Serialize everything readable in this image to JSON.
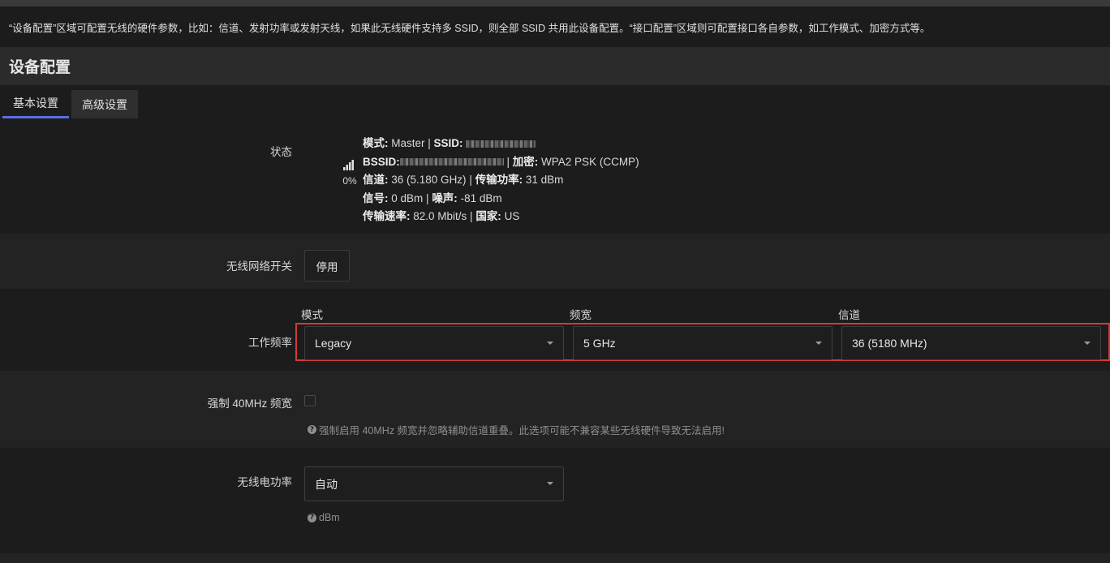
{
  "description": "“设备配置”区域可配置无线的硬件参数，比如：信道、发射功率或发射天线，如果此无线硬件支持多 SSID，则全部 SSID 共用此设备配置。“接口配置”区域则可配置接口各自参数，如工作模式、加密方式等。",
  "section_title": "设备配置",
  "tabs": [
    {
      "label": "基本设置",
      "active": true
    },
    {
      "label": "高级设置",
      "active": false
    }
  ],
  "status": {
    "label": "状态",
    "signal_percent": "0%",
    "signal_icon": "signal-bars-icon",
    "mode_label": "模式:",
    "mode_value": "Master",
    "ssid_label": "SSID:",
    "bssid_label": "BSSID:",
    "encryption_label": "加密:",
    "encryption_value": "WPA2 PSK (CCMP)",
    "channel_label": "信道:",
    "channel_value": "36 (5.180 GHz)",
    "txpower_label": "传输功率:",
    "txpower_value": "31 dBm",
    "signal_label": "信号:",
    "signal_value": "0 dBm",
    "noise_label": "噪声:",
    "noise_value": "-81 dBm",
    "bitrate_label": "传输速率:",
    "bitrate_value": "82.0 Mbit/s",
    "country_label": "国家:",
    "country_value": "US"
  },
  "wireless_switch": {
    "label": "无线网络开关",
    "button_label": "停用"
  },
  "frequency": {
    "label": "工作频率",
    "mode_label": "模式",
    "mode_value": "Legacy",
    "width_label": "频宽",
    "width_value": "5 GHz",
    "channel_label": "信道",
    "channel_value": "36 (5180 MHz)"
  },
  "force_40mhz": {
    "label": "强制 40MHz 频宽",
    "checked": false,
    "help": "强制启用 40MHz 频宽并忽略辅助信道重叠。此选项可能不兼容某些无线硬件导致无法启用!"
  },
  "txpower": {
    "label": "无线电功率",
    "value": "自动",
    "help": "dBm"
  },
  "colors": {
    "background": "#1c1c1c",
    "accent_tab": "#5b6ee1",
    "highlight_border": "#d23a3a"
  }
}
